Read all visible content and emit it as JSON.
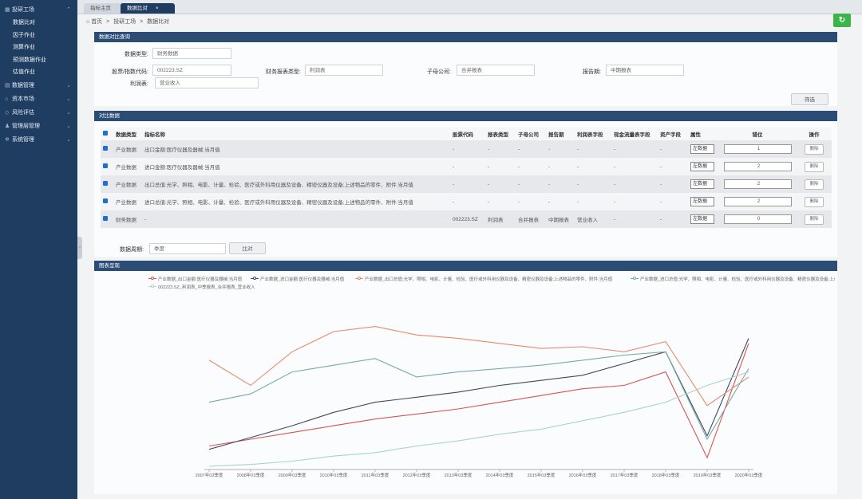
{
  "sidebar": {
    "sections": [
      {
        "label": "投研工场",
        "expanded": true,
        "subs": [
          "数据比对",
          "因子作业",
          "测算作业",
          "预测数据作业",
          "估值作业"
        ]
      },
      {
        "label": "数据管理",
        "expanded": false
      },
      {
        "label": "资本市场",
        "expanded": false
      },
      {
        "label": "风险评估",
        "expanded": false
      },
      {
        "label": "管理层管理",
        "expanded": false
      },
      {
        "label": "系统管理",
        "expanded": false
      }
    ]
  },
  "tabs": {
    "first": "指标主页",
    "active": "数据比对",
    "close": "×"
  },
  "breadcrumb": {
    "home": "首页",
    "sep": ">",
    "level1": "投研工场",
    "level2": "数据比对"
  },
  "refresh_icon": "↻",
  "query": {
    "title": "数据对比查询",
    "data_type_label": "数据类型:",
    "data_type_value": "财务数据",
    "stock_code_label": "股票/指数代码:",
    "stock_code_value": "002223.SZ",
    "report_type_label": "财务报表类型:",
    "report_type_value": "利润表",
    "subsidiary_label": "子母公司:",
    "subsidiary_value": "合并报表",
    "period_label": "报告期:",
    "period_value": "中期报表",
    "profit_label": "利润表:",
    "profit_value": "营业收入",
    "filter_button": "筛选"
  },
  "compare": {
    "title": "对比数据",
    "headers": [
      "数据类型",
      "指标名称",
      "股票代码",
      "报表类型",
      "子母公司",
      "报告期",
      "利润表字段",
      "现金流量表字段",
      "资产字段",
      "属性",
      "错位",
      "操作"
    ],
    "rows": [
      {
        "type": "产业数据",
        "name": "出口金额:医疗仪器及器械:当月值",
        "code": "-",
        "rtype": "-",
        "sub": "-",
        "period": "-",
        "pfield": "-",
        "cfield": "-",
        "afield": "-",
        "attr": "左数据",
        "offset": "1",
        "op": "删除"
      },
      {
        "type": "产业数据",
        "name": "进口金额:医疗仪器及器械:当月值",
        "code": "-",
        "rtype": "-",
        "sub": "-",
        "period": "-",
        "pfield": "-",
        "cfield": "-",
        "afield": "-",
        "attr": "左数据",
        "offset": "2",
        "op": "删除"
      },
      {
        "type": "产业数据",
        "name": "出口总值:光学、照相、电影、计量、检验、医疗或外科用仪器及设备、精密仪器及设备;上述物品的零件、附件:当月值",
        "code": "-",
        "rtype": "-",
        "sub": "-",
        "period": "-",
        "pfield": "-",
        "cfield": "-",
        "afield": "-",
        "attr": "左数据",
        "offset": "2",
        "op": "删除"
      },
      {
        "type": "产业数据",
        "name": "进口总值:光学、照相、电影、计量、检验、医疗或外科用仪器及设备、精密仪器及设备;上述物品的零件、附件:当月值",
        "code": "-",
        "rtype": "-",
        "sub": "-",
        "period": "-",
        "pfield": "-",
        "cfield": "-",
        "afield": "-",
        "attr": "左数据",
        "offset": "2",
        "op": "删除"
      },
      {
        "type": "财务数据",
        "name": "-",
        "code": "002223.SZ",
        "rtype": "利润表",
        "sub": "合并报表",
        "period": "中期报表",
        "pfield": "营业收入",
        "cfield": "-",
        "afield": "-",
        "attr": "左数据",
        "offset": "0",
        "op": "删除"
      }
    ],
    "cycle_label": "数据周期:",
    "cycle_value": "季度",
    "compare_button": "比对"
  },
  "chart_panel": {
    "title": "图表呈现"
  },
  "chart_data": {
    "type": "line",
    "legend_position": "top",
    "grid": false,
    "x": [
      "2007年03季度",
      "2008年03季度",
      "2009年03季度",
      "2010年03季度",
      "2011年03季度",
      "2012年03季度",
      "2013年03季度",
      "2014年03季度",
      "2015年03季度",
      "2016年03季度",
      "2017年03季度",
      "2018年03季度",
      "2019年03季度",
      "2020年03季度"
    ],
    "series": [
      {
        "name": "产业数据_出口金额:医疗仪器及器械:当月值",
        "color": "#d9534f",
        "values": [
          14,
          18,
          22,
          26,
          30,
          33,
          36,
          40,
          44,
          48,
          50,
          58,
          7,
          75
        ]
      },
      {
        "name": "产业数据_进口金额:医疗仪器及器械:当月值",
        "color": "#3f4a5e",
        "values": [
          12,
          19,
          26,
          34,
          40,
          43,
          46,
          50,
          53,
          56,
          63,
          70,
          20,
          78
        ]
      },
      {
        "name": "产业数据_出口总值:光学、照相、电影、计量、检验、医疗或外科用仪器及设备、精密仪器及设备;上述物品的零件、附件:当月值",
        "color": "#e8896e",
        "values": [
          65,
          50,
          70,
          82,
          85,
          80,
          78,
          75,
          72,
          73,
          70,
          76,
          38,
          55
        ]
      },
      {
        "name": "产业数据_进口总值:光学、照相、电影、计量、检验、医疗或外科用仪器及设备、精密仪器及设备;上述物品的零件、附件:当月值",
        "color": "#78a9a7",
        "values": [
          40,
          45,
          58,
          62,
          66,
          55,
          58,
          60,
          62,
          65,
          68,
          70,
          18,
          60
        ]
      },
      {
        "name": "002223.SZ_利润表_中季报表_合并报表_营业收入",
        "color": "#a6d7be",
        "values": [
          2,
          3,
          5,
          8,
          10,
          14,
          17,
          21,
          24,
          29,
          34,
          40,
          50,
          58
        ]
      }
    ]
  }
}
